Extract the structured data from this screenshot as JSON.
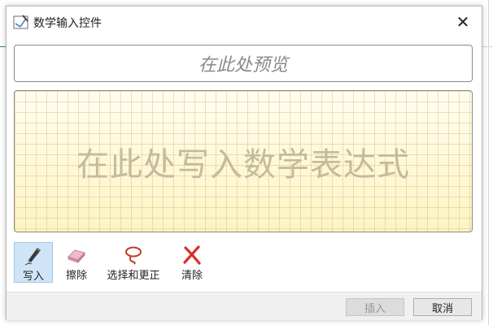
{
  "window": {
    "title": "数学输入控件",
    "close_glyph": "✕"
  },
  "preview": {
    "placeholder": "在此处预览"
  },
  "writing_pad": {
    "placeholder": "在此处写入数学表达式"
  },
  "tools": [
    {
      "label": "写入",
      "icon": "pen-icon",
      "active": true
    },
    {
      "label": "擦除",
      "icon": "eraser-icon",
      "active": false
    },
    {
      "label": "选择和更正",
      "icon": "lasso-icon",
      "active": false
    },
    {
      "label": "清除",
      "icon": "clear-x-icon",
      "active": false
    }
  ],
  "buttons": {
    "insert": "插入",
    "cancel": "取消"
  },
  "colors": {
    "active_tool_bg": "#cfe5f7",
    "pad_bg": "#fdf6cf",
    "clear_icon": "#d93025"
  }
}
